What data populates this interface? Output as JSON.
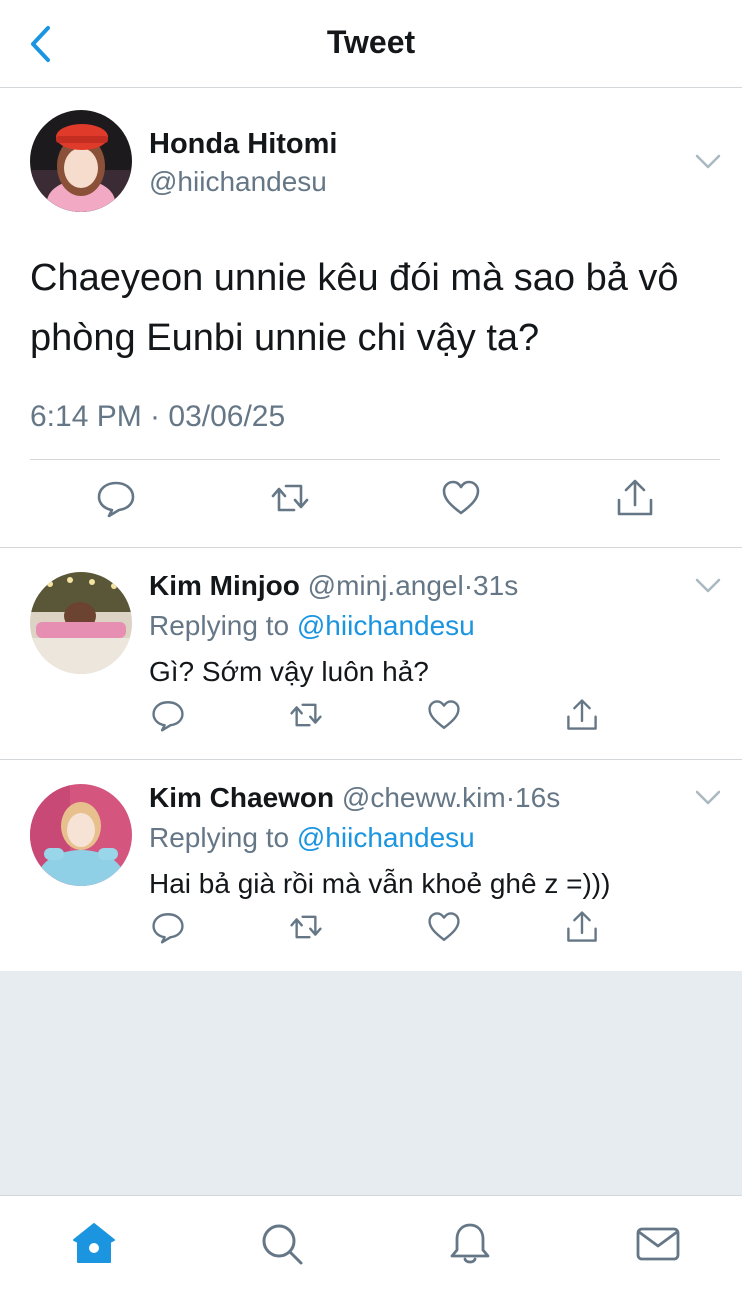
{
  "header": {
    "title": "Tweet",
    "back_icon": "chevron-left-icon"
  },
  "colors": {
    "accent": "#1b95e0",
    "text": "#14171a",
    "secondary": "#657786",
    "divider": "#d4d7da",
    "background_gray": "#e6ecf0"
  },
  "main_tweet": {
    "author_name": "Honda Hitomi",
    "author_handle": "@hiichandesu",
    "text": "Chaeyeon unnie kêu đói mà sao bả vô phòng Eunbi unnie chi vậy ta?",
    "timestamp": "6:14 PM · 03/06/25",
    "actions": [
      "reply-icon",
      "retweet-icon",
      "like-icon",
      "share-icon"
    ]
  },
  "replies": [
    {
      "author_name": "Kim Minjoo",
      "author_handle": "@minj.angel",
      "separator": "·",
      "time": "31s",
      "replying_prefix": "Replying to",
      "replying_to": "@hiichandesu",
      "text": "Gì? Sớm vậy luôn hả?"
    },
    {
      "author_name": "Kim Chaewon",
      "author_handle": "@cheww.kim",
      "separator": "·",
      "time": "16s",
      "replying_prefix": "Replying to",
      "replying_to": "@hiichandesu",
      "text": "Hai bả già rồi mà vẫn khoẻ ghê z =)))"
    }
  ],
  "tabbar": {
    "items": [
      "home-icon",
      "search-icon",
      "notifications-icon",
      "messages-icon"
    ],
    "active": "home-icon"
  }
}
